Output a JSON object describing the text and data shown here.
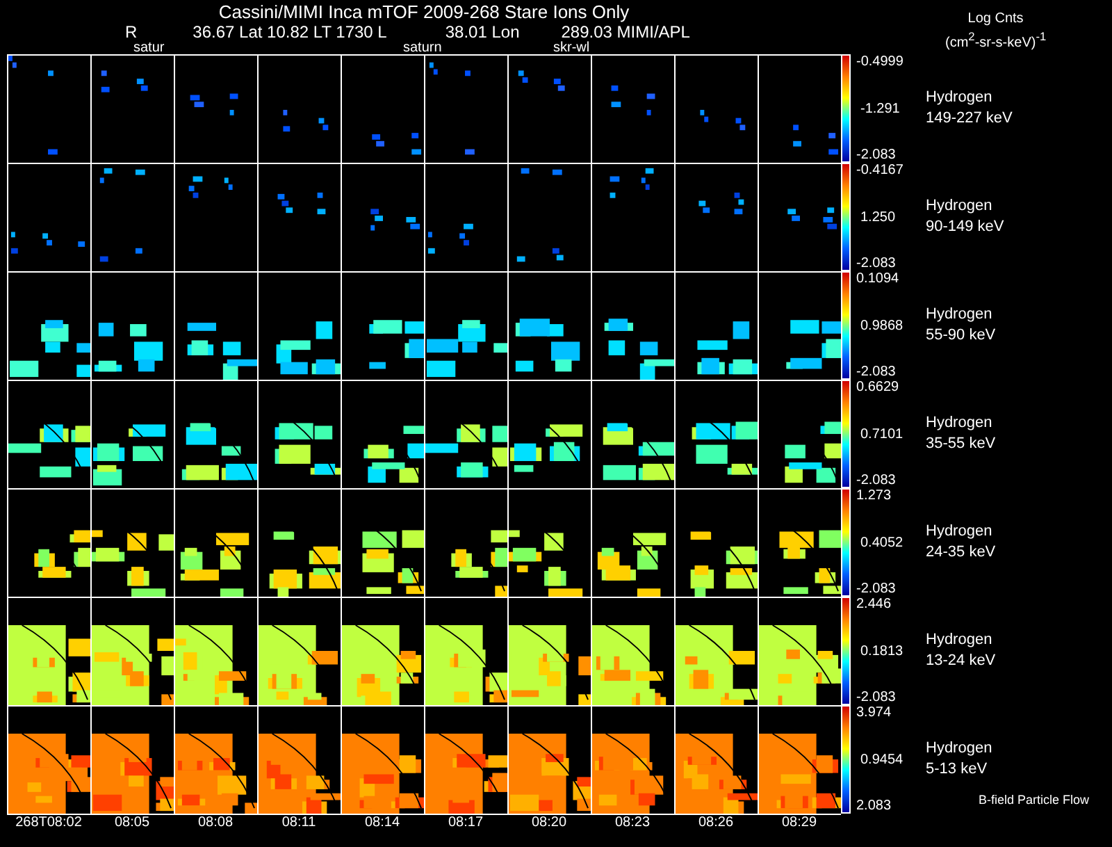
{
  "title": "Cassini/MIMI Inca mTOF  2009-268   Stare   Ions Only",
  "position": [
    "R",
    "36.67 Lat 10.82 LT 1730 L",
    "38.01 Lon",
    "289.03  MIMI/APL"
  ],
  "overlay_labels": [
    "satur",
    "saturn",
    "skr-wl"
  ],
  "units": {
    "title": "Log Cnts",
    "unit": "(cm$^{2}$-sr-s-keV)$^{-1}$"
  },
  "rows": [
    {
      "species": "Hydrogen",
      "energy": "149-227 keV",
      "scale_max": "-0.4999",
      "scale_mid": "-1.291",
      "scale_min": "-2.083"
    },
    {
      "species": "Hydrogen",
      "energy": "90-149 keV",
      "scale_max": "-0.4167",
      "scale_mid": "1.250",
      "scale_min": "-2.083"
    },
    {
      "species": "Hydrogen",
      "energy": "55-90 keV",
      "scale_max": "0.1094",
      "scale_mid": "0.9868",
      "scale_min": "-2.083"
    },
    {
      "species": "Hydrogen",
      "energy": "35-55 keV",
      "scale_max": "0.6629",
      "scale_mid": "0.7101",
      "scale_min": "-2.083"
    },
    {
      "species": "Hydrogen",
      "energy": "24-35 keV",
      "scale_max": "1.273",
      "scale_mid": "0.4052",
      "scale_min": "-2.083"
    },
    {
      "species": "Hydrogen",
      "energy": "13-24 keV",
      "scale_max": "2.446",
      "scale_mid": "0.1813",
      "scale_min": "-2.083"
    },
    {
      "species": "Hydrogen",
      "energy": "5-13 keV",
      "scale_max": "3.974",
      "scale_mid": "0.9454",
      "scale_min": "2.083"
    }
  ],
  "legend_note": "B-field Particle Flow",
  "times": [
    "268T08:02",
    "08:05",
    "08:08",
    "08:11",
    "08:14",
    "08:17",
    "08:20",
    "08:23",
    "08:26",
    "08:29"
  ]
}
